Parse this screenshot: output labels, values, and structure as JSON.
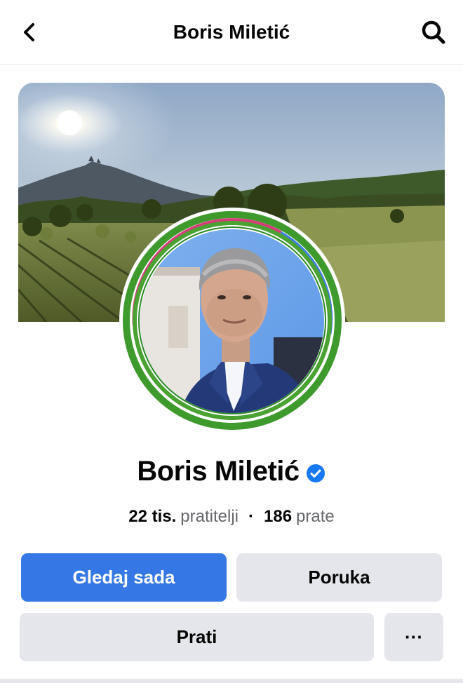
{
  "header": {
    "title": "Boris Miletić",
    "back_icon": "chevron-left-icon",
    "search_icon": "search-icon"
  },
  "profile": {
    "name": "Boris Miletić",
    "verified_icon": "verified-badge-icon",
    "cover_photo": "hilltop-town-and-vineyard-landscape",
    "avatar": "profile-photo-with-green-ring",
    "ring_color": "#43a047"
  },
  "stats": {
    "followers_count": "22 tis.",
    "followers_label": "pratitelji",
    "separator": "·",
    "following_count": "186",
    "following_label": "prate"
  },
  "actions": {
    "watch_label": "Gledaj sada",
    "message_label": "Poruka",
    "follow_label": "Prati",
    "more_label": "···"
  },
  "colors": {
    "primary": "#3578e5",
    "secondary_button": "#e4e6eb",
    "verified": "#1877f2",
    "muted_text": "#65676b"
  }
}
